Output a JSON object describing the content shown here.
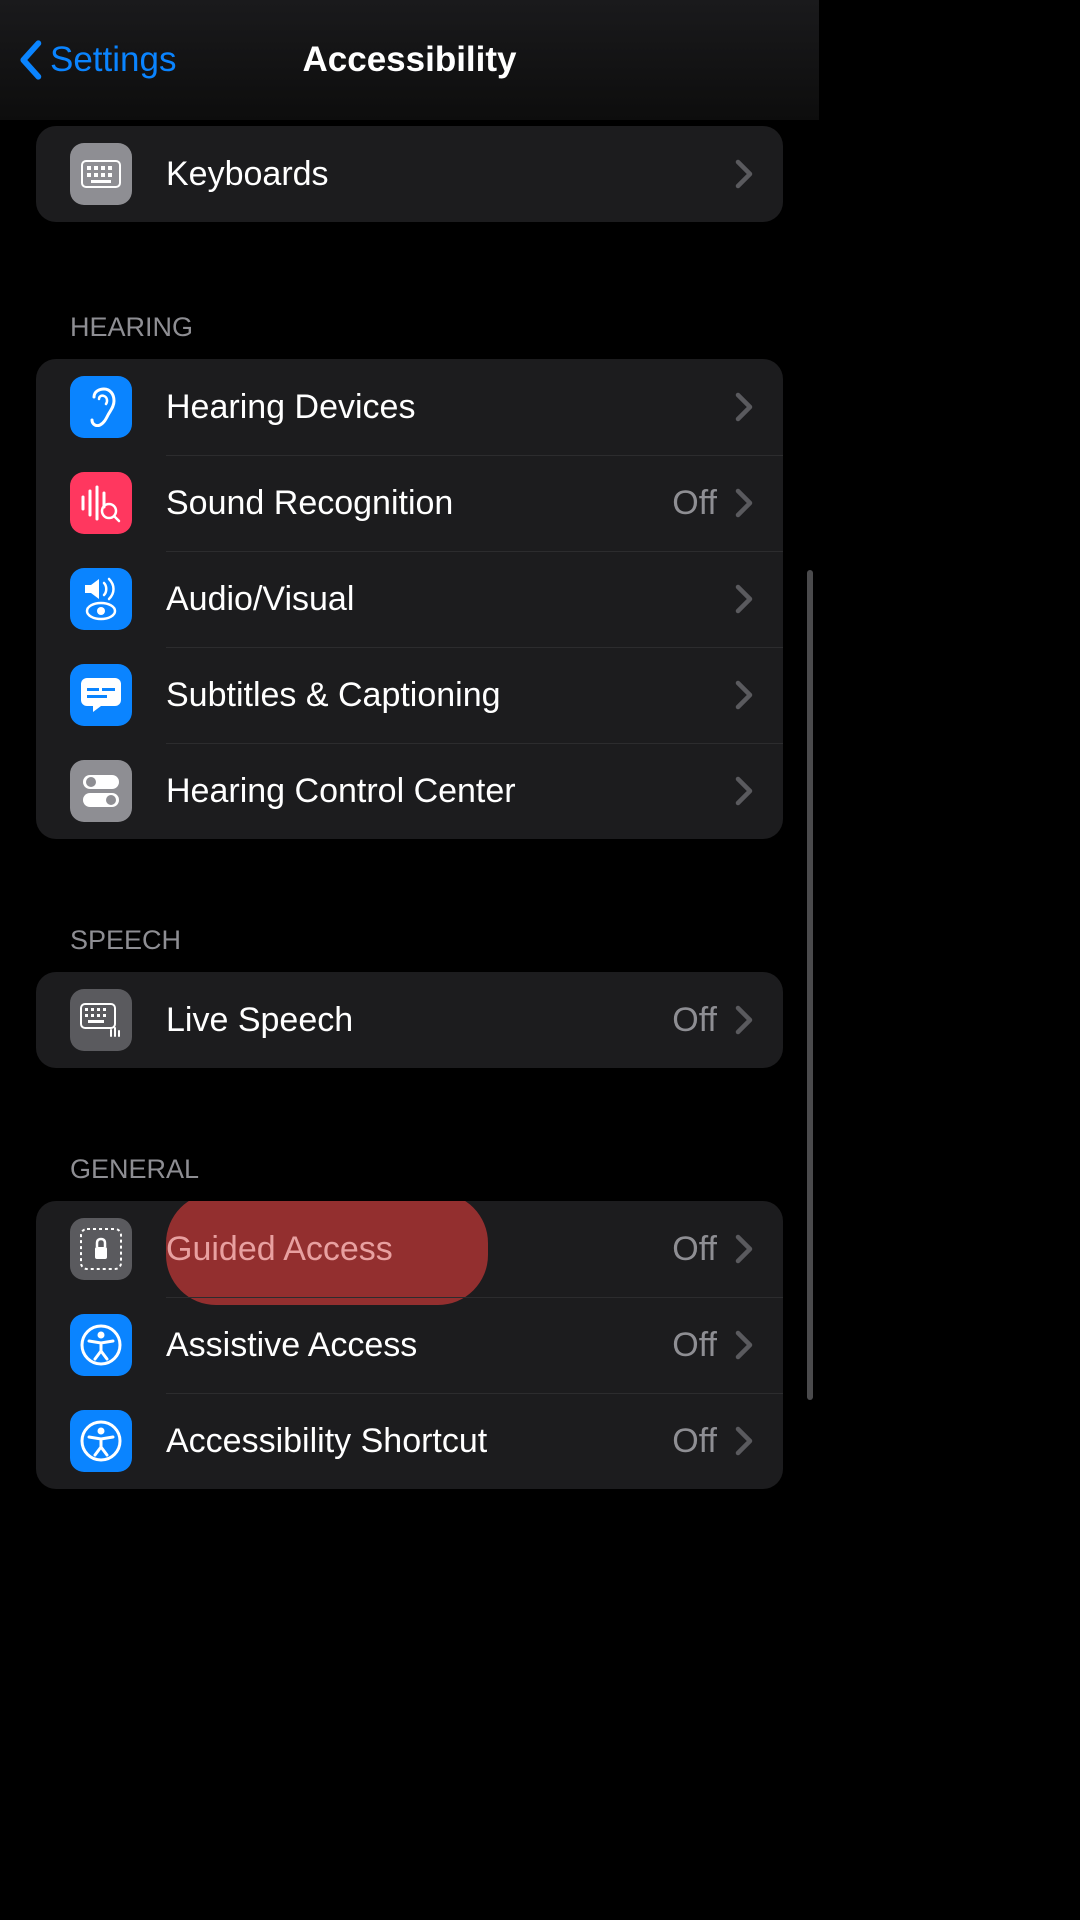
{
  "header": {
    "back_label": "Settings",
    "title": "Accessibility"
  },
  "sections": {
    "physical": {
      "items": {
        "keyboards": {
          "label": "Keyboards"
        }
      }
    },
    "hearing": {
      "title": "Hearing",
      "items": {
        "hearing_devices": {
          "label": "Hearing Devices"
        },
        "sound_recognition": {
          "label": "Sound Recognition",
          "value": "Off"
        },
        "audio_visual": {
          "label": "Audio/Visual"
        },
        "subtitles": {
          "label": "Subtitles & Captioning"
        },
        "hearing_control_center": {
          "label": "Hearing Control Center"
        }
      }
    },
    "speech": {
      "title": "Speech",
      "items": {
        "live_speech": {
          "label": "Live Speech",
          "value": "Off"
        }
      }
    },
    "general": {
      "title": "General",
      "items": {
        "guided_access": {
          "label": "Guided Access",
          "value": "Off"
        },
        "assistive_access": {
          "label": "Assistive Access",
          "value": "Off"
        },
        "accessibility_shortcut": {
          "label": "Accessibility Shortcut",
          "value": "Off"
        }
      }
    }
  }
}
